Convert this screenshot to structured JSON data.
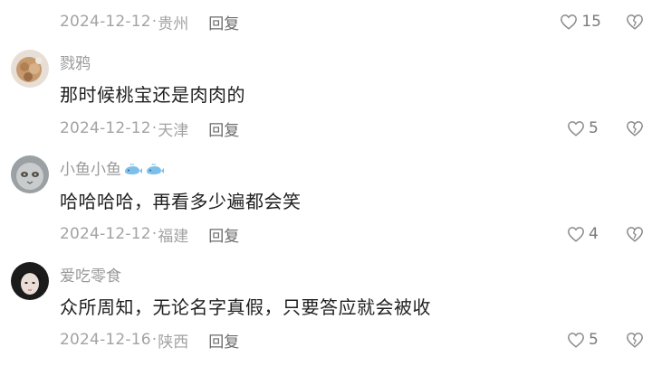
{
  "comments": [
    {
      "date": "2024-12-12",
      "location": "贵州",
      "reply_label": "回复",
      "likes": "15"
    },
    {
      "username": "戮鸦",
      "text": "那时候桃宝还是肉肉的",
      "date": "2024-12-12",
      "location": "天津",
      "reply_label": "回复",
      "likes": "5"
    },
    {
      "username": "小鱼小鱼",
      "username_emoji": [
        "whale-icon",
        "whale-icon"
      ],
      "text": "哈哈哈哈，再看多少遍都会笑",
      "date": "2024-12-12",
      "location": "福建",
      "reply_label": "回复",
      "likes": "4"
    },
    {
      "username": "爱吃零食",
      "text": "众所周知，无论名字真假，只要答应就会被收",
      "date": "2024-12-16",
      "location": "陕西",
      "reply_label": "回复",
      "likes": "5"
    }
  ],
  "separator": "·",
  "icons": {
    "like": "heart-outline-icon",
    "dislike": "broken-heart-icon"
  },
  "colors": {
    "meta_text": "#a3a3a3",
    "reply_text": "#6b6b6b",
    "comment_text": "#1f1f1f",
    "username_text": "#9a9a9a"
  }
}
